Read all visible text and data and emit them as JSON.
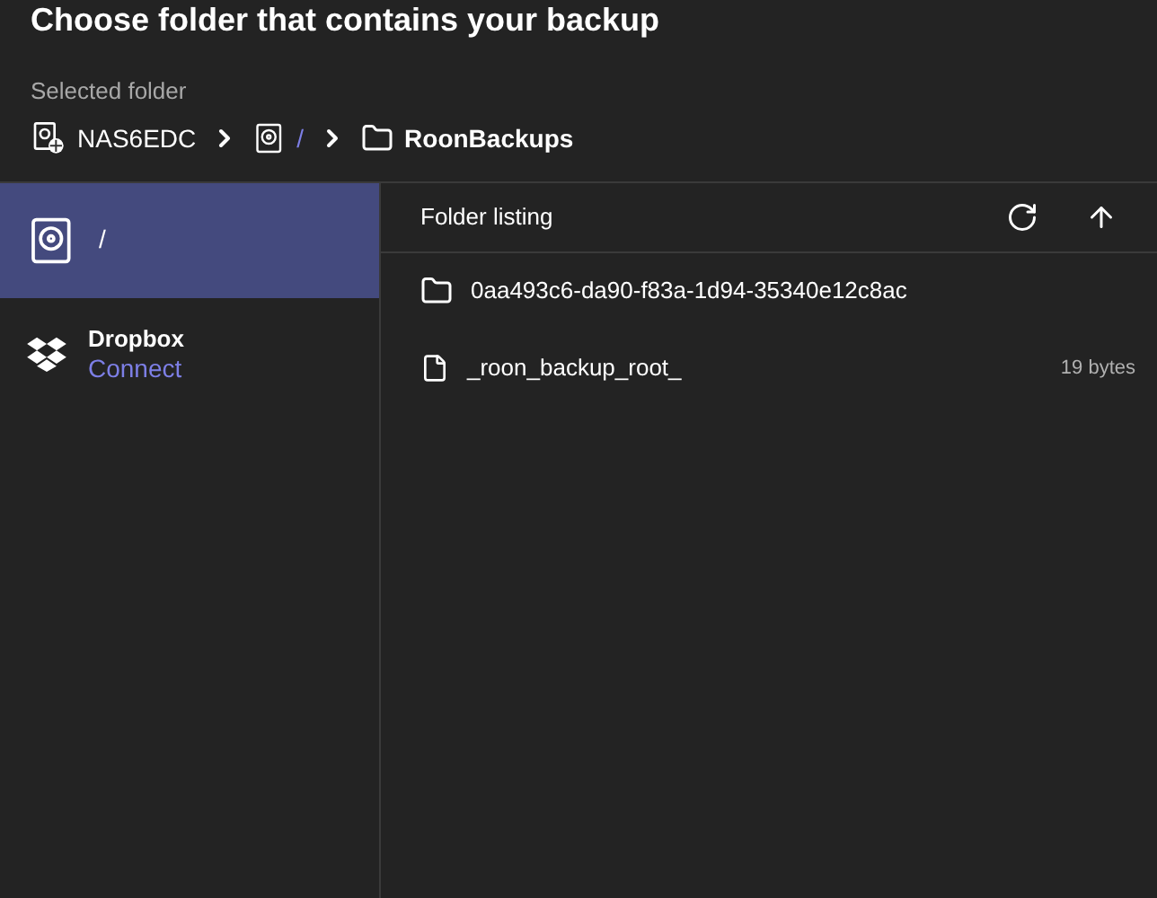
{
  "title": "Choose folder that contains your backup",
  "selected_folder": {
    "label": "Selected folder",
    "path": [
      {
        "kind": "nas",
        "text": "NAS6EDC",
        "link": false
      },
      {
        "kind": "drive",
        "text": "/",
        "link": true
      },
      {
        "kind": "folder",
        "text": "RoonBackups",
        "link": false
      }
    ]
  },
  "sidebar": {
    "items": [
      {
        "kind": "drive",
        "label": "/",
        "selected": true
      },
      {
        "kind": "dropbox",
        "label": "Dropbox",
        "action": "Connect",
        "selected": false
      }
    ]
  },
  "listing": {
    "title": "Folder listing",
    "rows": [
      {
        "kind": "folder",
        "name": "0aa493c6-da90-f83a-1d94-35340e12c8ac"
      },
      {
        "kind": "file",
        "name": "_roon_backup_root_",
        "size": "19 bytes"
      }
    ]
  }
}
